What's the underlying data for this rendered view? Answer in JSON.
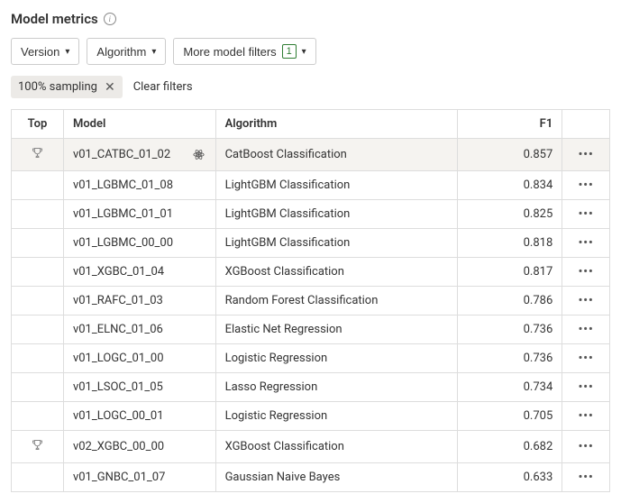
{
  "header": {
    "title": "Model metrics"
  },
  "filters": {
    "version_label": "Version",
    "algorithm_label": "Algorithm",
    "more_label": "More model filters",
    "more_count": "1"
  },
  "chips": {
    "sampling_label": "100% sampling",
    "clear_label": "Clear filters"
  },
  "table": {
    "headers": {
      "top": "Top",
      "model": "Model",
      "algorithm": "Algorithm",
      "f1": "F1",
      "actions": ""
    },
    "rows": [
      {
        "top": true,
        "model": "v01_CATBC_01_02",
        "algorithm": "CatBoost Classification",
        "f1": "0.857",
        "highlight": true,
        "atom": true
      },
      {
        "top": false,
        "model": "v01_LGBMC_01_08",
        "algorithm": "LightGBM Classification",
        "f1": "0.834",
        "highlight": false,
        "atom": false
      },
      {
        "top": false,
        "model": "v01_LGBMC_01_01",
        "algorithm": "LightGBM Classification",
        "f1": "0.825",
        "highlight": false,
        "atom": false
      },
      {
        "top": false,
        "model": "v01_LGBMC_00_00",
        "algorithm": "LightGBM Classification",
        "f1": "0.818",
        "highlight": false,
        "atom": false
      },
      {
        "top": false,
        "model": "v01_XGBC_01_04",
        "algorithm": "XGBoost Classification",
        "f1": "0.817",
        "highlight": false,
        "atom": false
      },
      {
        "top": false,
        "model": "v01_RAFC_01_03",
        "algorithm": "Random Forest Classification",
        "f1": "0.786",
        "highlight": false,
        "atom": false
      },
      {
        "top": false,
        "model": "v01_ELNC_01_06",
        "algorithm": "Elastic Net Regression",
        "f1": "0.736",
        "highlight": false,
        "atom": false
      },
      {
        "top": false,
        "model": "v01_LOGC_01_00",
        "algorithm": "Logistic Regression",
        "f1": "0.736",
        "highlight": false,
        "atom": false
      },
      {
        "top": false,
        "model": "v01_LSOC_01_05",
        "algorithm": "Lasso Regression",
        "f1": "0.734",
        "highlight": false,
        "atom": false
      },
      {
        "top": false,
        "model": "v01_LOGC_00_01",
        "algorithm": "Logistic Regression",
        "f1": "0.705",
        "highlight": false,
        "atom": false
      },
      {
        "top": true,
        "model": "v02_XGBC_00_00",
        "algorithm": "XGBoost Classification",
        "f1": "0.682",
        "highlight": false,
        "atom": false
      },
      {
        "top": false,
        "model": "v01_GNBC_01_07",
        "algorithm": "Gaussian Naive Bayes",
        "f1": "0.633",
        "highlight": false,
        "atom": false
      }
    ]
  }
}
